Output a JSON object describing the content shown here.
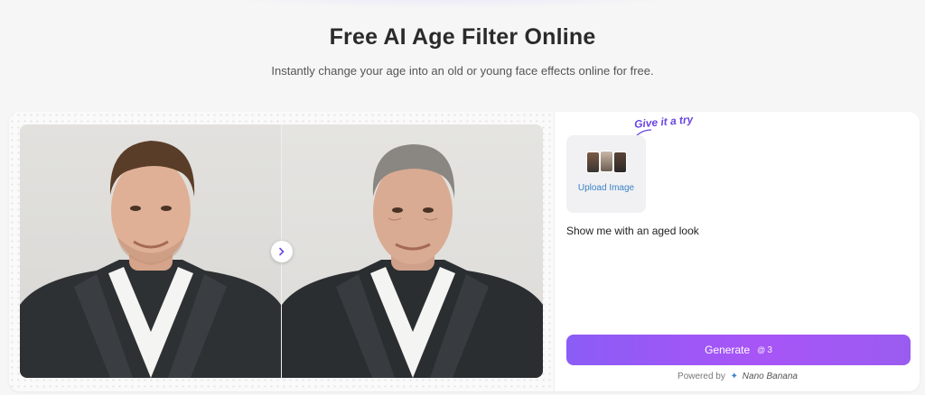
{
  "header": {
    "title": "Free AI Age Filter Online",
    "subtitle": "Instantly change your age into an old or young face effects online for free."
  },
  "preview": {
    "before_image": "young-man-portrait",
    "after_image": "aged-man-portrait",
    "arrow_icon": "chevron-right-icon"
  },
  "panel": {
    "hint": "Give it a try",
    "upload_label": "Upload Image",
    "prompt": "Show me with an aged look",
    "generate_label": "Generate",
    "credit_icon": "@",
    "credit_cost": "3",
    "powered_prefix": "Powered by",
    "powered_brand": "Nano Banana"
  },
  "colors": {
    "accent": "#8b5cf6",
    "link": "#3b82c8",
    "hint": "#6b46e0"
  }
}
